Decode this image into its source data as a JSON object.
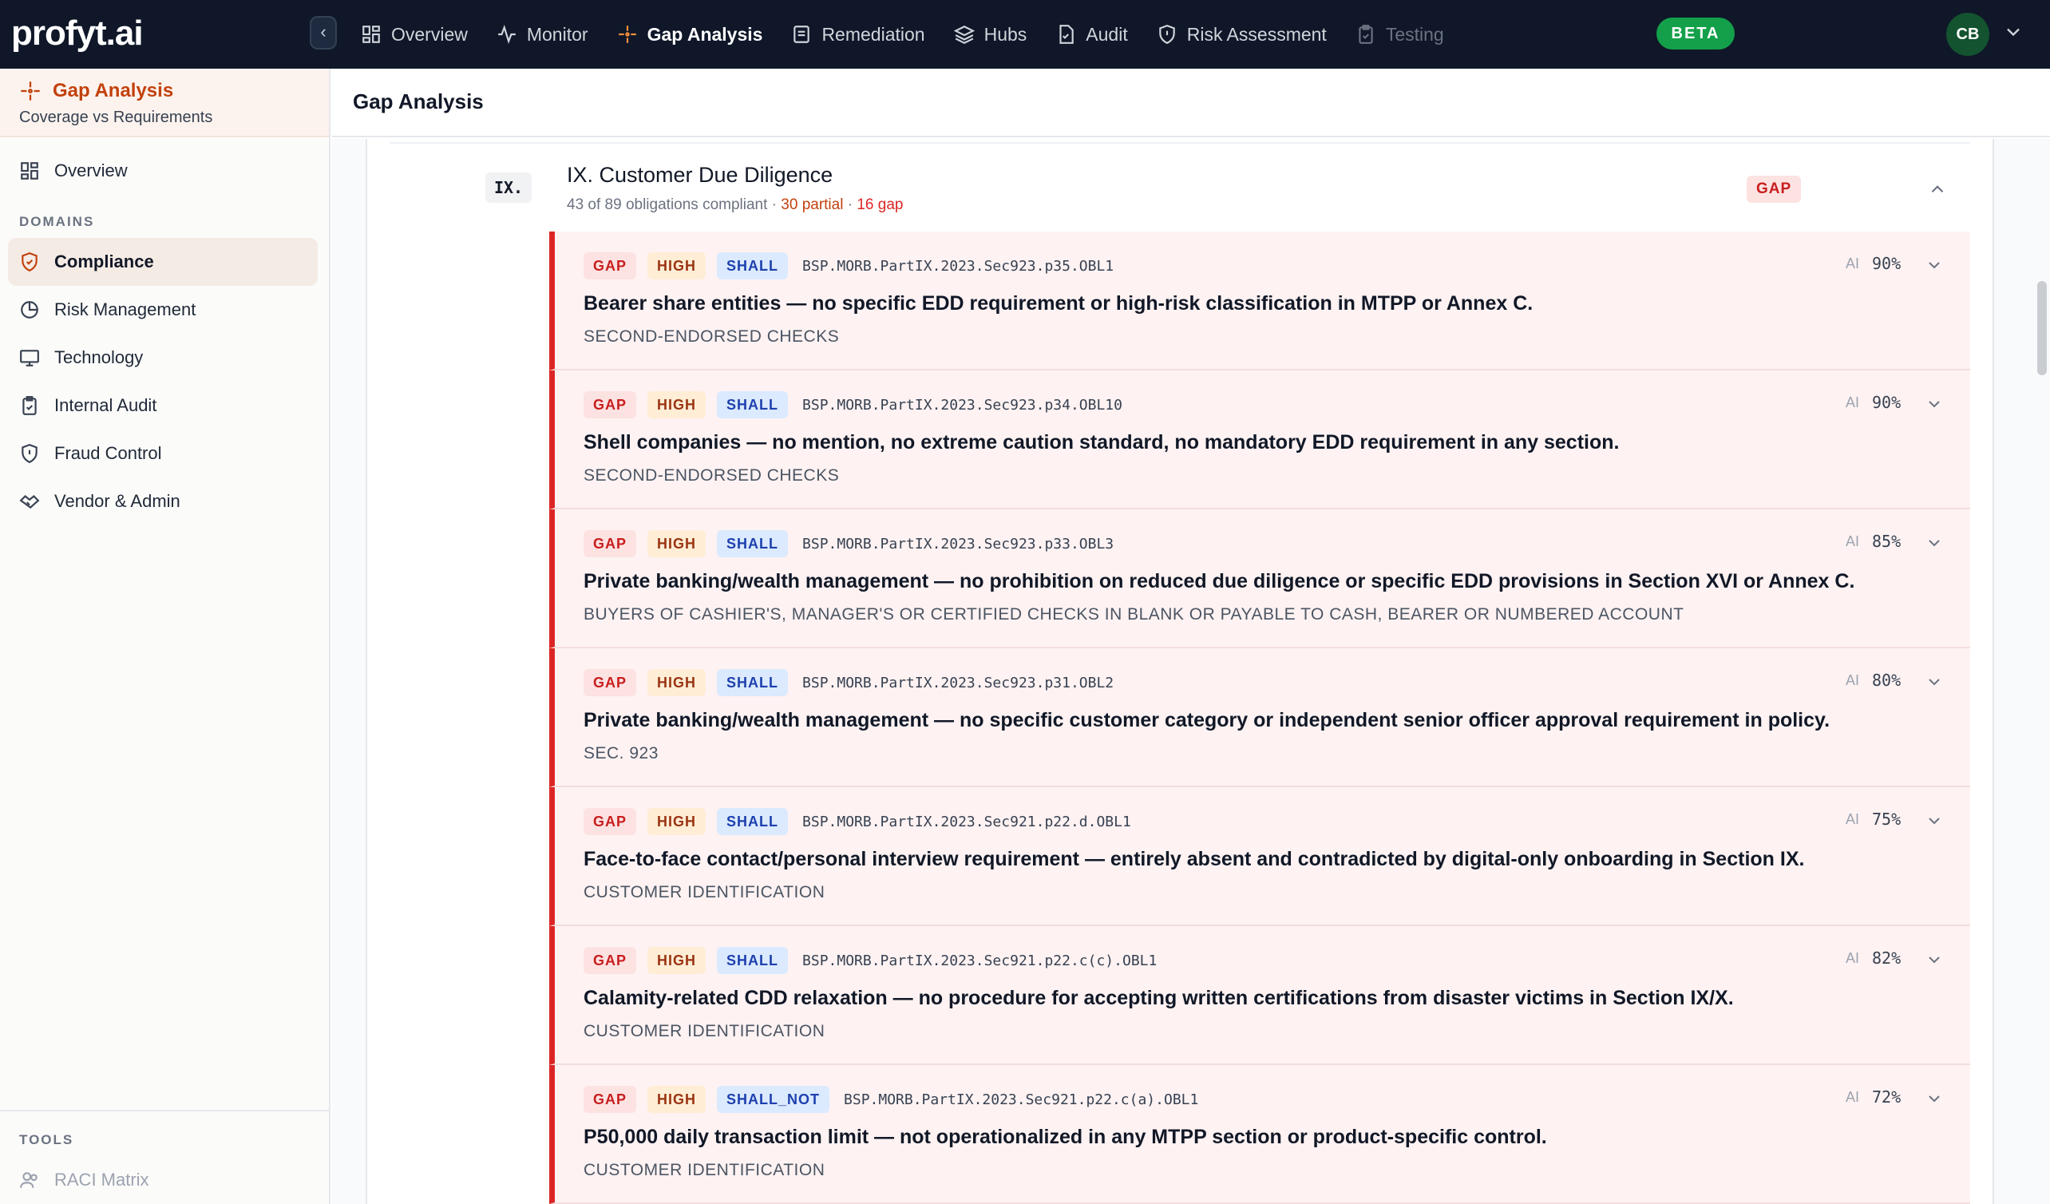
{
  "brand": {
    "logo_text": "profyt.ai"
  },
  "topnav": {
    "items": [
      {
        "label": "Overview",
        "icon": "grid-icon"
      },
      {
        "label": "Monitor",
        "icon": "activity-icon"
      },
      {
        "label": "Gap Analysis",
        "icon": "sparkle-icon",
        "active": true
      },
      {
        "label": "Remediation",
        "icon": "clipboard-list-icon"
      },
      {
        "label": "Hubs",
        "icon": "layers-icon"
      },
      {
        "label": "Audit",
        "icon": "file-check-icon"
      },
      {
        "label": "Risk Assessment",
        "icon": "shield-icon"
      },
      {
        "label": "Testing",
        "icon": "clipboard-check-icon",
        "disabled": true
      }
    ],
    "beta_label": "BETA",
    "avatar_initials": "CB"
  },
  "sidebar": {
    "header_title": "Gap Analysis",
    "header_subtitle": "Coverage vs Requirements",
    "overview_label": "Overview",
    "domains_heading": "DOMAINS",
    "domains": [
      {
        "label": "Compliance",
        "icon": "shield-check-icon",
        "active": true
      },
      {
        "label": "Risk Management",
        "icon": "pie-chart-icon"
      },
      {
        "label": "Technology",
        "icon": "monitor-icon"
      },
      {
        "label": "Internal Audit",
        "icon": "clipboard-icon"
      },
      {
        "label": "Fraud Control",
        "icon": "shield-icon"
      },
      {
        "label": "Vendor & Admin",
        "icon": "handshake-icon"
      }
    ],
    "tools_heading": "TOOLS",
    "tools": [
      {
        "label": "RACI Matrix",
        "icon": "users-icon"
      }
    ]
  },
  "page": {
    "title": "Gap Analysis"
  },
  "section": {
    "roman": "IX.",
    "title": "IX. Customer Due Diligence",
    "meta_compliant": "43 of 89 obligations compliant",
    "meta_sep": " · ",
    "meta_partial": "30 partial",
    "meta_gap": "16 gap",
    "badge": "GAP"
  },
  "ai_label": "AI",
  "colors": {
    "accent": "#c2410c",
    "gap": "#dc2626",
    "topbar": "#0f1729",
    "beta": "#14a04a"
  },
  "obligations": [
    {
      "status": "GAP",
      "severity": "HIGH",
      "modality": "SHALL",
      "id": "BSP.MORB.PartIX.2023.Sec923.p35.OBL1",
      "confidence": "90%",
      "title": "Bearer share entities — no specific EDD requirement or high-risk classification in MTPP or Annex C.",
      "category": "SECOND-ENDORSED CHECKS"
    },
    {
      "status": "GAP",
      "severity": "HIGH",
      "modality": "SHALL",
      "id": "BSP.MORB.PartIX.2023.Sec923.p34.OBL10",
      "confidence": "90%",
      "title": "Shell companies — no mention, no extreme caution standard, no mandatory EDD requirement in any section.",
      "category": "SECOND-ENDORSED CHECKS"
    },
    {
      "status": "GAP",
      "severity": "HIGH",
      "modality": "SHALL",
      "id": "BSP.MORB.PartIX.2023.Sec923.p33.OBL3",
      "confidence": "85%",
      "title": "Private banking/wealth management — no prohibition on reduced due diligence or specific EDD provisions in Section XVI or Annex C.",
      "category": "BUYERS OF CASHIER'S, MANAGER'S OR CERTIFIED CHECKS IN BLANK OR PAYABLE TO CASH, BEARER OR NUMBERED ACCOUNT"
    },
    {
      "status": "GAP",
      "severity": "HIGH",
      "modality": "SHALL",
      "id": "BSP.MORB.PartIX.2023.Sec923.p31.OBL2",
      "confidence": "80%",
      "title": "Private banking/wealth management — no specific customer category or independent senior officer approval requirement in policy.",
      "category": "SEC. 923"
    },
    {
      "status": "GAP",
      "severity": "HIGH",
      "modality": "SHALL",
      "id": "BSP.MORB.PartIX.2023.Sec921.p22.d.OBL1",
      "confidence": "75%",
      "title": "Face-to-face contact/personal interview requirement — entirely absent and contradicted by digital-only onboarding in Section IX.",
      "category": "CUSTOMER IDENTIFICATION"
    },
    {
      "status": "GAP",
      "severity": "HIGH",
      "modality": "SHALL",
      "id": "BSP.MORB.PartIX.2023.Sec921.p22.c(c).OBL1",
      "confidence": "82%",
      "title": "Calamity-related CDD relaxation — no procedure for accepting written certifications from disaster victims in Section IX/X.",
      "category": "CUSTOMER IDENTIFICATION"
    },
    {
      "status": "GAP",
      "severity": "HIGH",
      "modality": "SHALL_NOT",
      "id": "BSP.MORB.PartIX.2023.Sec921.p22.c(a).OBL1",
      "confidence": "72%",
      "title": "P50,000 daily transaction limit — not operationalized in any MTPP section or product-specific control.",
      "category": "CUSTOMER IDENTIFICATION"
    }
  ]
}
